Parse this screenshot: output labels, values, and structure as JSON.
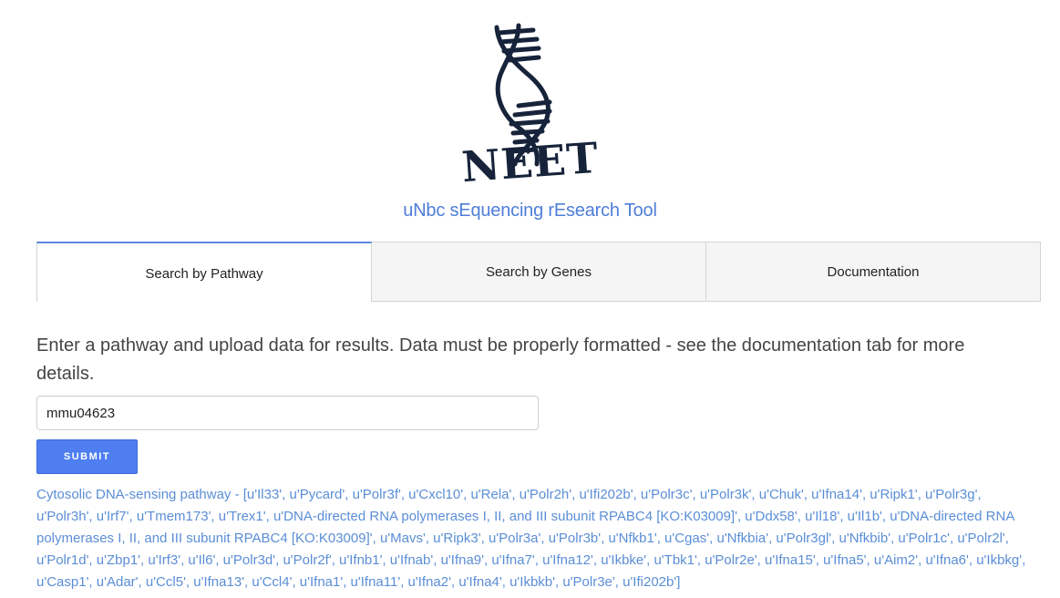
{
  "logo": {
    "text": "NEET",
    "icon": "dna-helix-icon"
  },
  "subtitle": "uNbc sEquencing rEsearch Tool",
  "tabs": [
    {
      "label": "Search by Pathway",
      "active": true
    },
    {
      "label": "Search by Genes",
      "active": false
    },
    {
      "label": "Documentation",
      "active": false
    }
  ],
  "intro_text": "Enter a pathway and upload data for results. Data must be properly formatted - see the documentation tab for more details.",
  "pathway_input": {
    "value": "mmu04623"
  },
  "submit_label": "SUBMIT",
  "result_text": "Cytosolic DNA-sensing pathway - [u'Il33', u'Pycard', u'Polr3f', u'Cxcl10', u'Rela', u'Polr2h', u'Ifi202b', u'Polr3c', u'Polr3k', u'Chuk', u'Ifna14', u'Ripk1', u'Polr3g', u'Polr3h', u'Irf7', u'Tmem173', u'Trex1', u'DNA-directed RNA polymerases I, II, and III subunit RPABC4 [KO:K03009]', u'Ddx58', u'Il18', u'Il1b', u'DNA-directed RNA polymerases I, II, and III subunit RPABC4 [KO:K03009]', u'Mavs', u'Ripk3', u'Polr3a', u'Polr3b', u'Nfkb1', u'Cgas', u'Nfkbia', u'Polr3gl', u'Nfkbib', u'Polr1c', u'Polr2l', u'Polr1d', u'Zbp1', u'Irf3', u'Il6', u'Polr3d', u'Polr2f', u'Ifnb1', u'Ifnab', u'Ifna9', u'Ifna7', u'Ifna12', u'Ikbke', u'Tbk1', u'Polr2e', u'Ifna15', u'Ifna5', u'Aim2', u'Ifna6', u'Ikbkg', u'Casp1', u'Adar', u'Ccl5', u'Ifna13', u'Ccl4', u'Ifna1', u'Ifna11', u'Ifna2', u'Ifna4', u'Ikbkb', u'Polr3e', u'Ifi202b']",
  "colors": {
    "accent": "#4e7ef0",
    "subtitle": "#4e7ed8",
    "result": "#5b8ed6",
    "logo": "#17233a"
  }
}
